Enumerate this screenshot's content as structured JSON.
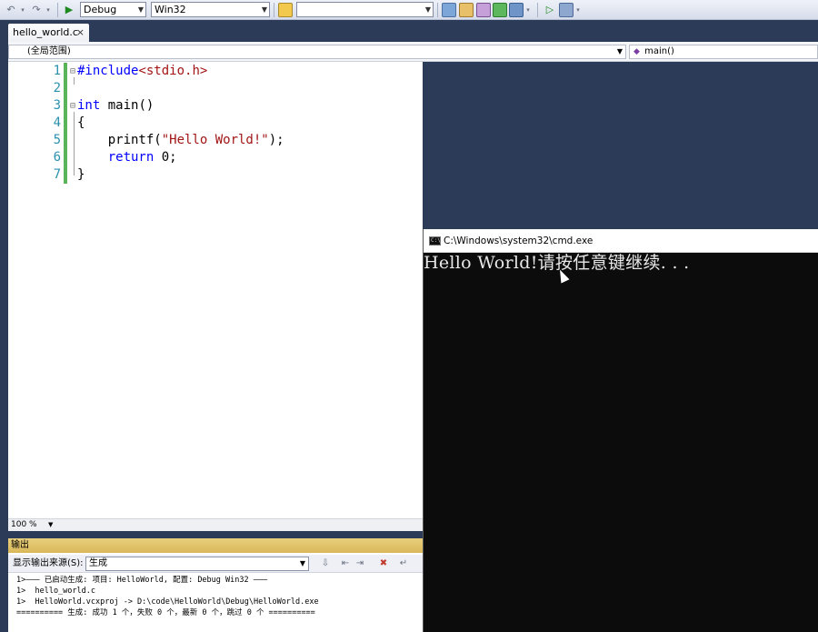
{
  "toolbar": {
    "config": "Debug",
    "platform": "Win32",
    "find_value": "",
    "undo_icon": "undo-icon",
    "redo_icon": "redo-icon",
    "start_icon": "start-debug-icon"
  },
  "tab": {
    "filename": "hello_world.c",
    "close": "×"
  },
  "navbar": {
    "scope": "(全局范围)",
    "function": "main()"
  },
  "editor": {
    "lines": [
      {
        "num": "1",
        "fold": "⊟",
        "parts": [
          {
            "t": "pp",
            "s": "#include"
          },
          {
            "t": "inc",
            "s": "<stdio.h>"
          }
        ]
      },
      {
        "num": "2",
        "fold": "",
        "parts": []
      },
      {
        "num": "3",
        "fold": "⊟",
        "parts": [
          {
            "t": "kw",
            "s": "int"
          },
          {
            "t": "",
            "s": " main()"
          }
        ]
      },
      {
        "num": "4",
        "fold": "",
        "parts": [
          {
            "t": "",
            "s": "{"
          }
        ]
      },
      {
        "num": "5",
        "fold": "",
        "parts": [
          {
            "t": "",
            "s": "    printf("
          },
          {
            "t": "str",
            "s": "\"Hello World!\""
          },
          {
            "t": "",
            "s": ");"
          }
        ]
      },
      {
        "num": "6",
        "fold": "",
        "parts": [
          {
            "t": "kw",
            "s": "    return"
          },
          {
            "t": "",
            "s": " 0;"
          }
        ]
      },
      {
        "num": "7",
        "fold": "",
        "parts": [
          {
            "t": "",
            "s": "}"
          }
        ]
      }
    ],
    "zoom": "100 %"
  },
  "output": {
    "title": "输出",
    "source_label": "显示输出来源(S):",
    "source_value": "生成",
    "lines": [
      "1>——— 已启动生成: 项目: HelloWorld, 配置: Debug Win32 ———",
      "1>  hello_world.c",
      "1>  HelloWorld.vcxproj -> D:\\code\\HelloWorld\\Debug\\HelloWorld.exe",
      "========== 生成: 成功 1 个，失败 0 个，最新 0 个，跳过 0 个 =========="
    ]
  },
  "console": {
    "title": "C:\\Windows\\system32\\cmd.exe",
    "icon_text": "C:\\",
    "output": "Hello World!请按任意键继续. . ."
  }
}
